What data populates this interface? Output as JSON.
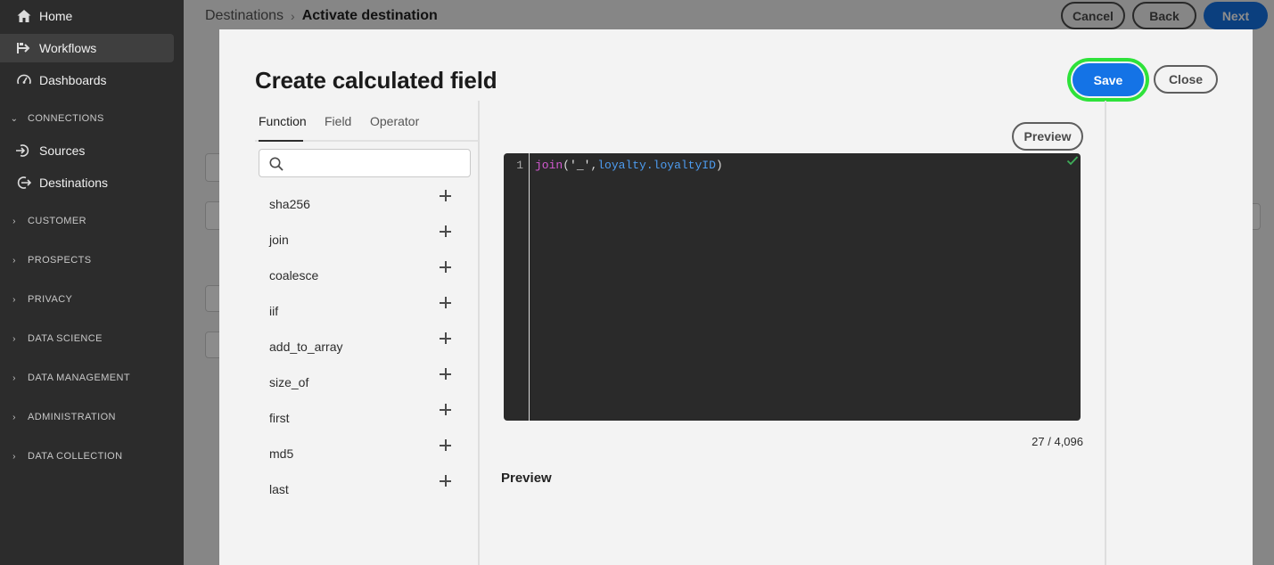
{
  "sidebar": {
    "home": "Home",
    "workflows": "Workflows",
    "dashboards": "Dashboards",
    "connections": "CONNECTIONS",
    "sources": "Sources",
    "destinations": "Destinations",
    "sections": [
      "CUSTOMER",
      "PROSPECTS",
      "PRIVACY",
      "DATA SCIENCE",
      "DATA MANAGEMENT",
      "ADMINISTRATION",
      "DATA COLLECTION"
    ]
  },
  "header": {
    "breadcrumb_parent": "Destinations",
    "breadcrumb_current": "Activate destination",
    "cancel": "Cancel",
    "back": "Back",
    "next": "Next"
  },
  "dialog": {
    "title": "Create calculated field",
    "save": "Save",
    "close": "Close",
    "tabs": [
      "Function",
      "Field",
      "Operator"
    ],
    "search_placeholder": "",
    "functions": [
      "sha256",
      "join",
      "coalesce",
      "iif",
      "add_to_array",
      "size_of",
      "first",
      "md5",
      "last"
    ],
    "preview_button": "Preview",
    "editor": {
      "line_number": "1",
      "code_fn": "join",
      "code_open": "(",
      "code_str": "'_'",
      "code_comma": ",",
      "code_field": "loyalty.loyaltyID",
      "code_close": ")"
    },
    "char_count": "27 / 4,096",
    "preview_label": "Preview"
  },
  "colors": {
    "accent": "#1473e6",
    "highlight": "#2ee23a",
    "sidebar_bg": "#2c2c2c"
  }
}
